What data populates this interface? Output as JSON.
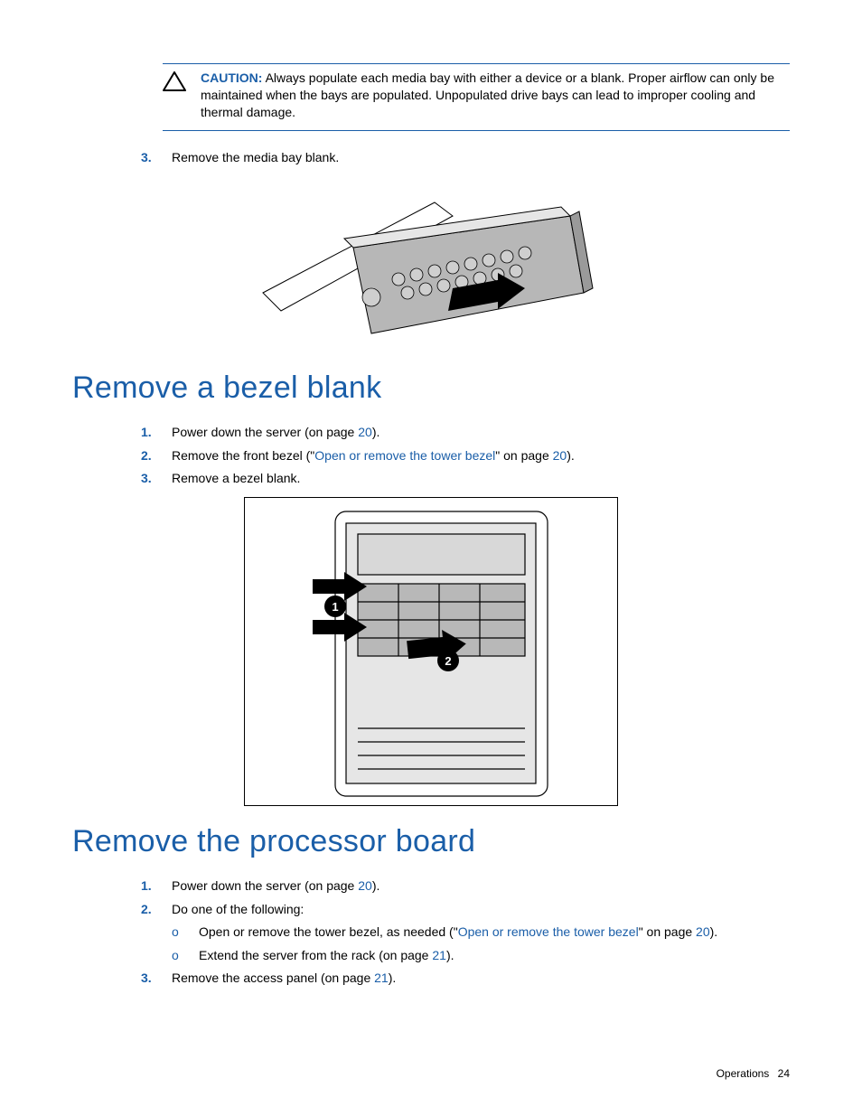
{
  "caution": {
    "label": "CAUTION:",
    "body_a": "Always populate each media bay with either a device or a blank. Proper airflow can only be maintained when the bays are populated. Unpopulated drive bays can lead to improper cooling and thermal damage."
  },
  "top_steps": {
    "s3_num": "3.",
    "s3_text": "Remove the media bay blank."
  },
  "heading1": "Remove a bezel blank",
  "h1_steps": {
    "s1_num": "1.",
    "s1_a": "Power down the server (on page ",
    "s1_link": "20",
    "s1_b": ").",
    "s2_num": "2.",
    "s2_a": "Remove the front bezel (\"",
    "s2_link1": "Open or remove the tower bezel",
    "s2_b": "\" on page ",
    "s2_link2": "20",
    "s2_c": ").",
    "s3_num": "3.",
    "s3_text": "Remove a bezel blank."
  },
  "heading2": "Remove the processor board",
  "h2_steps": {
    "s1_num": "1.",
    "s1_a": "Power down the server (on page ",
    "s1_link": "20",
    "s1_b": ").",
    "s2_num": "2.",
    "s2_text": "Do one of the following:",
    "sub1_bullet": "o",
    "sub1_a": "Open or remove the tower bezel, as needed (\"",
    "sub1_link1": "Open or remove the tower bezel",
    "sub1_b": "\" on page ",
    "sub1_link2": "20",
    "sub1_c": ").",
    "sub2_bullet": "o",
    "sub2_a": "Extend the server from the rack (on page ",
    "sub2_link": "21",
    "sub2_b": ").",
    "s3_num": "3.",
    "s3_a": "Remove the access panel (on page ",
    "s3_link": "21",
    "s3_b": ")."
  },
  "footer": {
    "section": "Operations",
    "page": "24"
  }
}
